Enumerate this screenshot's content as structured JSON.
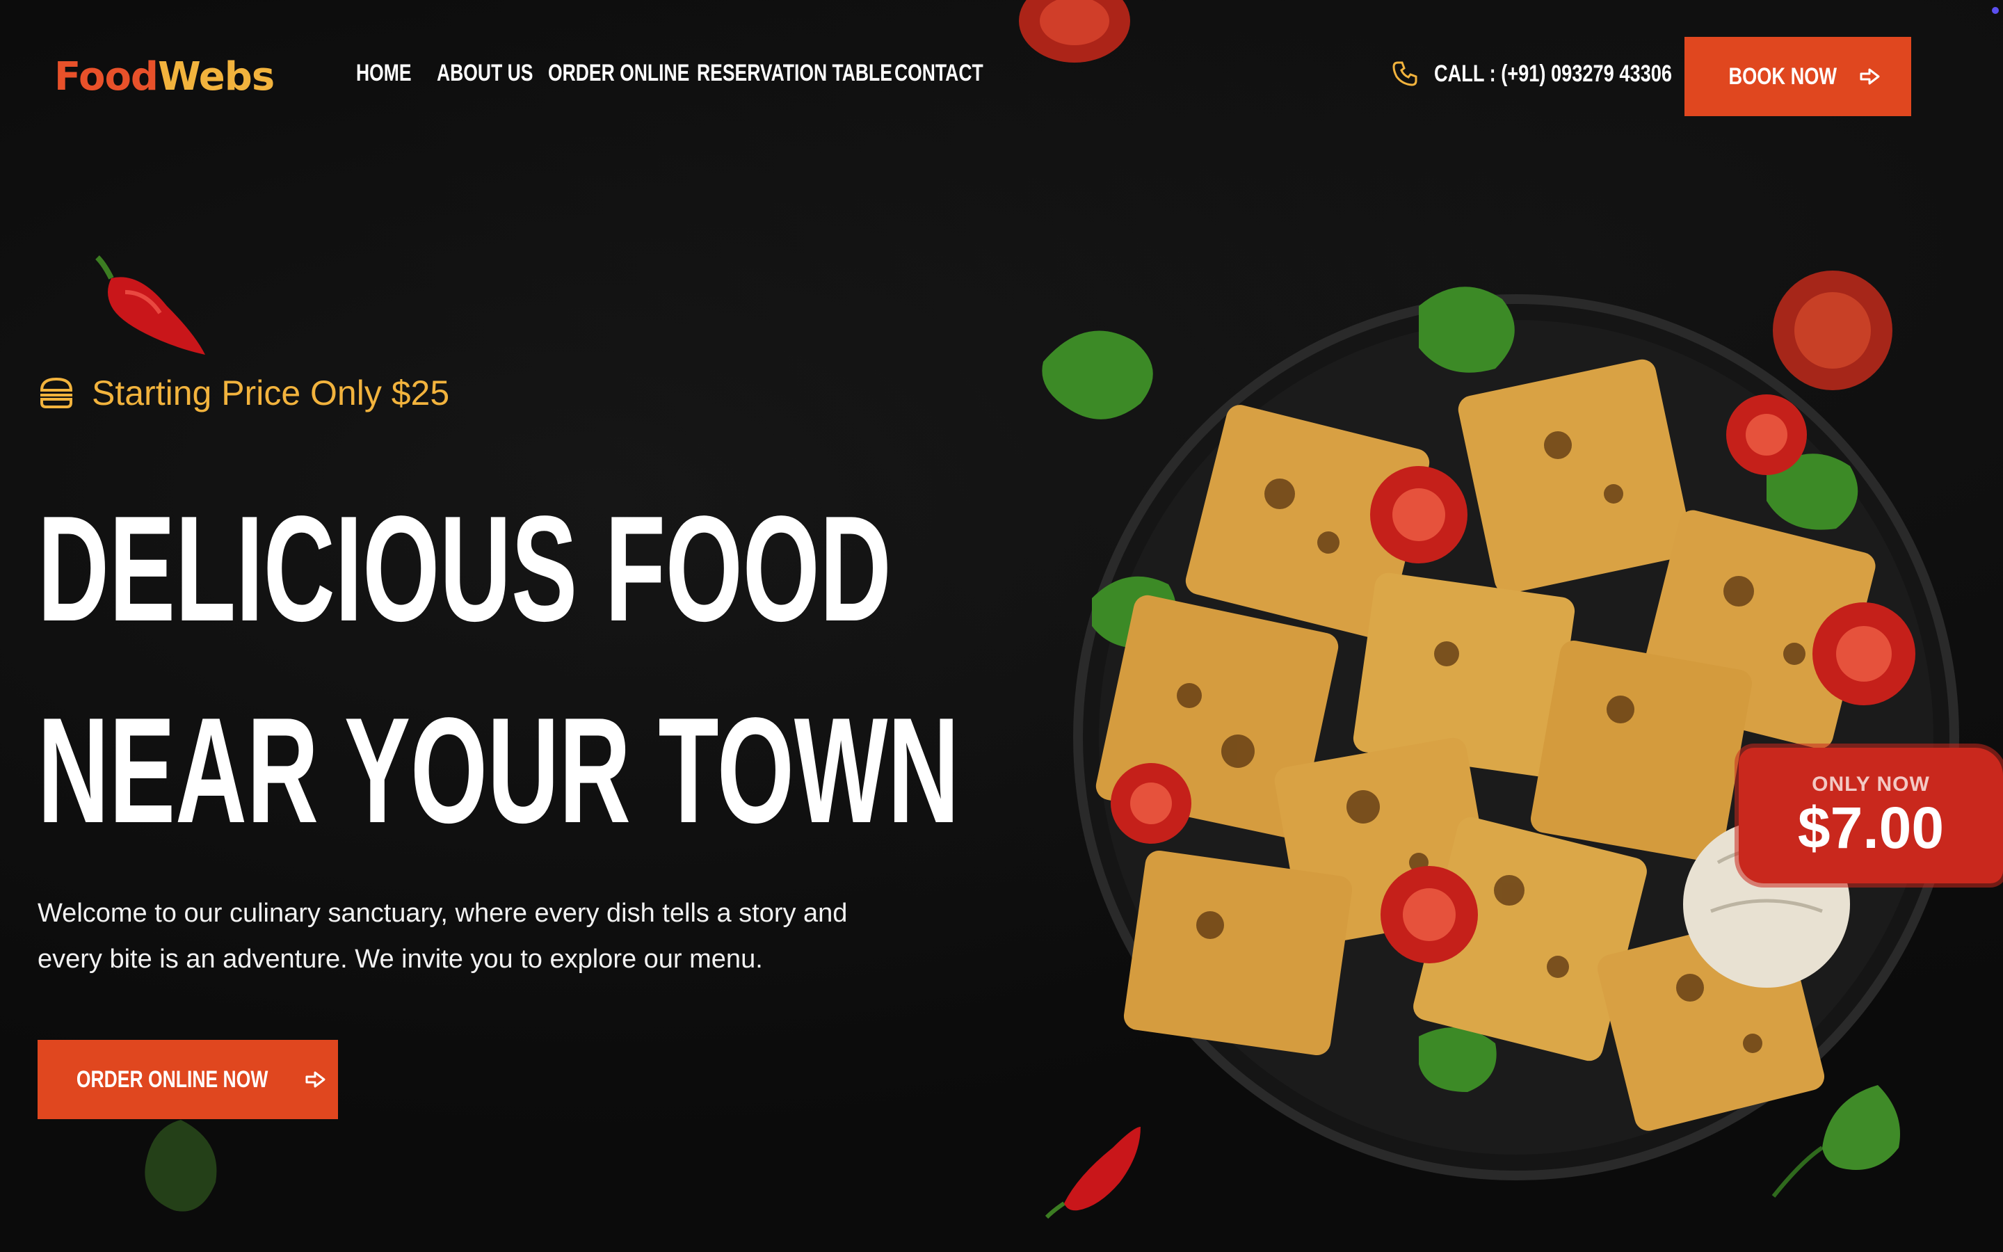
{
  "brand": {
    "logo_part1": "Food",
    "logo_part2": "Webs"
  },
  "nav": {
    "items": [
      "HOME",
      "ABOUT US",
      "ORDER ONLINE",
      "RESERVATION TABLE",
      "CONTACT"
    ]
  },
  "header": {
    "call_text": "CALL : (+91) 093279 43306",
    "book_label": "BOOK NOW"
  },
  "hero": {
    "tagline": "Starting Price Only $25",
    "headline_line1": "DELICIOUS FOOD",
    "headline_line2": "NEAR YOUR TOWN",
    "intro_line1": "Welcome to our culinary sanctuary, where every dish tells a story and",
    "intro_line2": "every bite is an adventure. We invite you to explore our menu.",
    "cta_label": "ORDER ONLINE NOW"
  },
  "promo": {
    "label": "ONLY NOW",
    "price": "$7.00"
  },
  "colors": {
    "accent": "#e0471f",
    "gold": "#f2b33d",
    "background": "#0a0a0a"
  },
  "icons": [
    "phone-icon",
    "arrow-right-icon",
    "burger-icon"
  ]
}
